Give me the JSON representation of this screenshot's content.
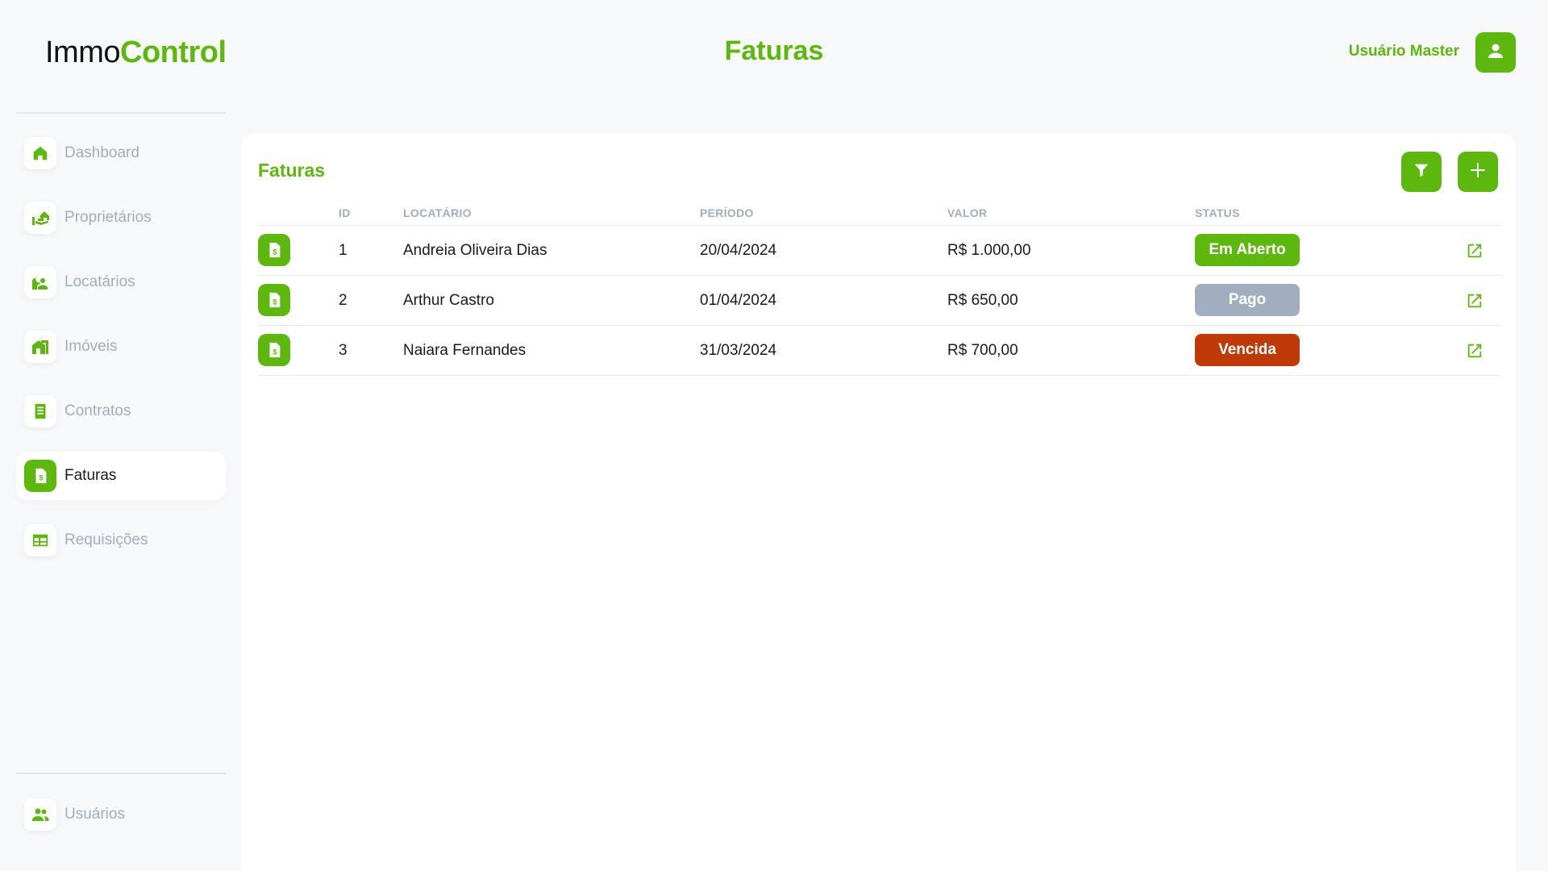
{
  "app": {
    "logo_part1": "Immo",
    "logo_part2": "Control",
    "page_title": "Faturas",
    "brand_color": "#5cb80c"
  },
  "user": {
    "name": "Usuário Master",
    "avatar_icon": "user-icon"
  },
  "sidebar": {
    "items": [
      {
        "label": "Dashboard",
        "icon": "home-icon",
        "active": false
      },
      {
        "label": "Proprietários",
        "icon": "owner-icon",
        "active": false
      },
      {
        "label": "Locatários",
        "icon": "tenant-icon",
        "active": false
      },
      {
        "label": "Imóveis",
        "icon": "building-icon",
        "active": false
      },
      {
        "label": "Contratos",
        "icon": "contract-icon",
        "active": false
      },
      {
        "label": "Faturas",
        "icon": "invoice-icon",
        "active": true
      },
      {
        "label": "Requisições",
        "icon": "table-icon",
        "active": false
      }
    ],
    "bottom_items": [
      {
        "label": "Usuários",
        "icon": "users-icon",
        "active": false
      }
    ]
  },
  "main": {
    "title": "Faturas",
    "filter_icon": "filter-icon",
    "add_icon": "plus-icon",
    "columns": [
      "ID",
      "LOCATÁRIO",
      "PERÍODO",
      "VALOR",
      "STATUS"
    ],
    "rows": [
      {
        "id": "1",
        "tenant": "Andreia Oliveira Dias",
        "period": "20/04/2024",
        "value": "R$ 1.000,00",
        "status": "Em Aberto",
        "status_color": "#5cb80c"
      },
      {
        "id": "2",
        "tenant": "Arthur Castro",
        "period": "01/04/2024",
        "value": "R$ 650,00",
        "status": "Pago",
        "status_color": "#a0aec0"
      },
      {
        "id": "3",
        "tenant": "Naiara Fernandes",
        "period": "31/03/2024",
        "value": "R$ 700,00",
        "status": "Vencida",
        "status_color": "#c03a08"
      }
    ]
  }
}
